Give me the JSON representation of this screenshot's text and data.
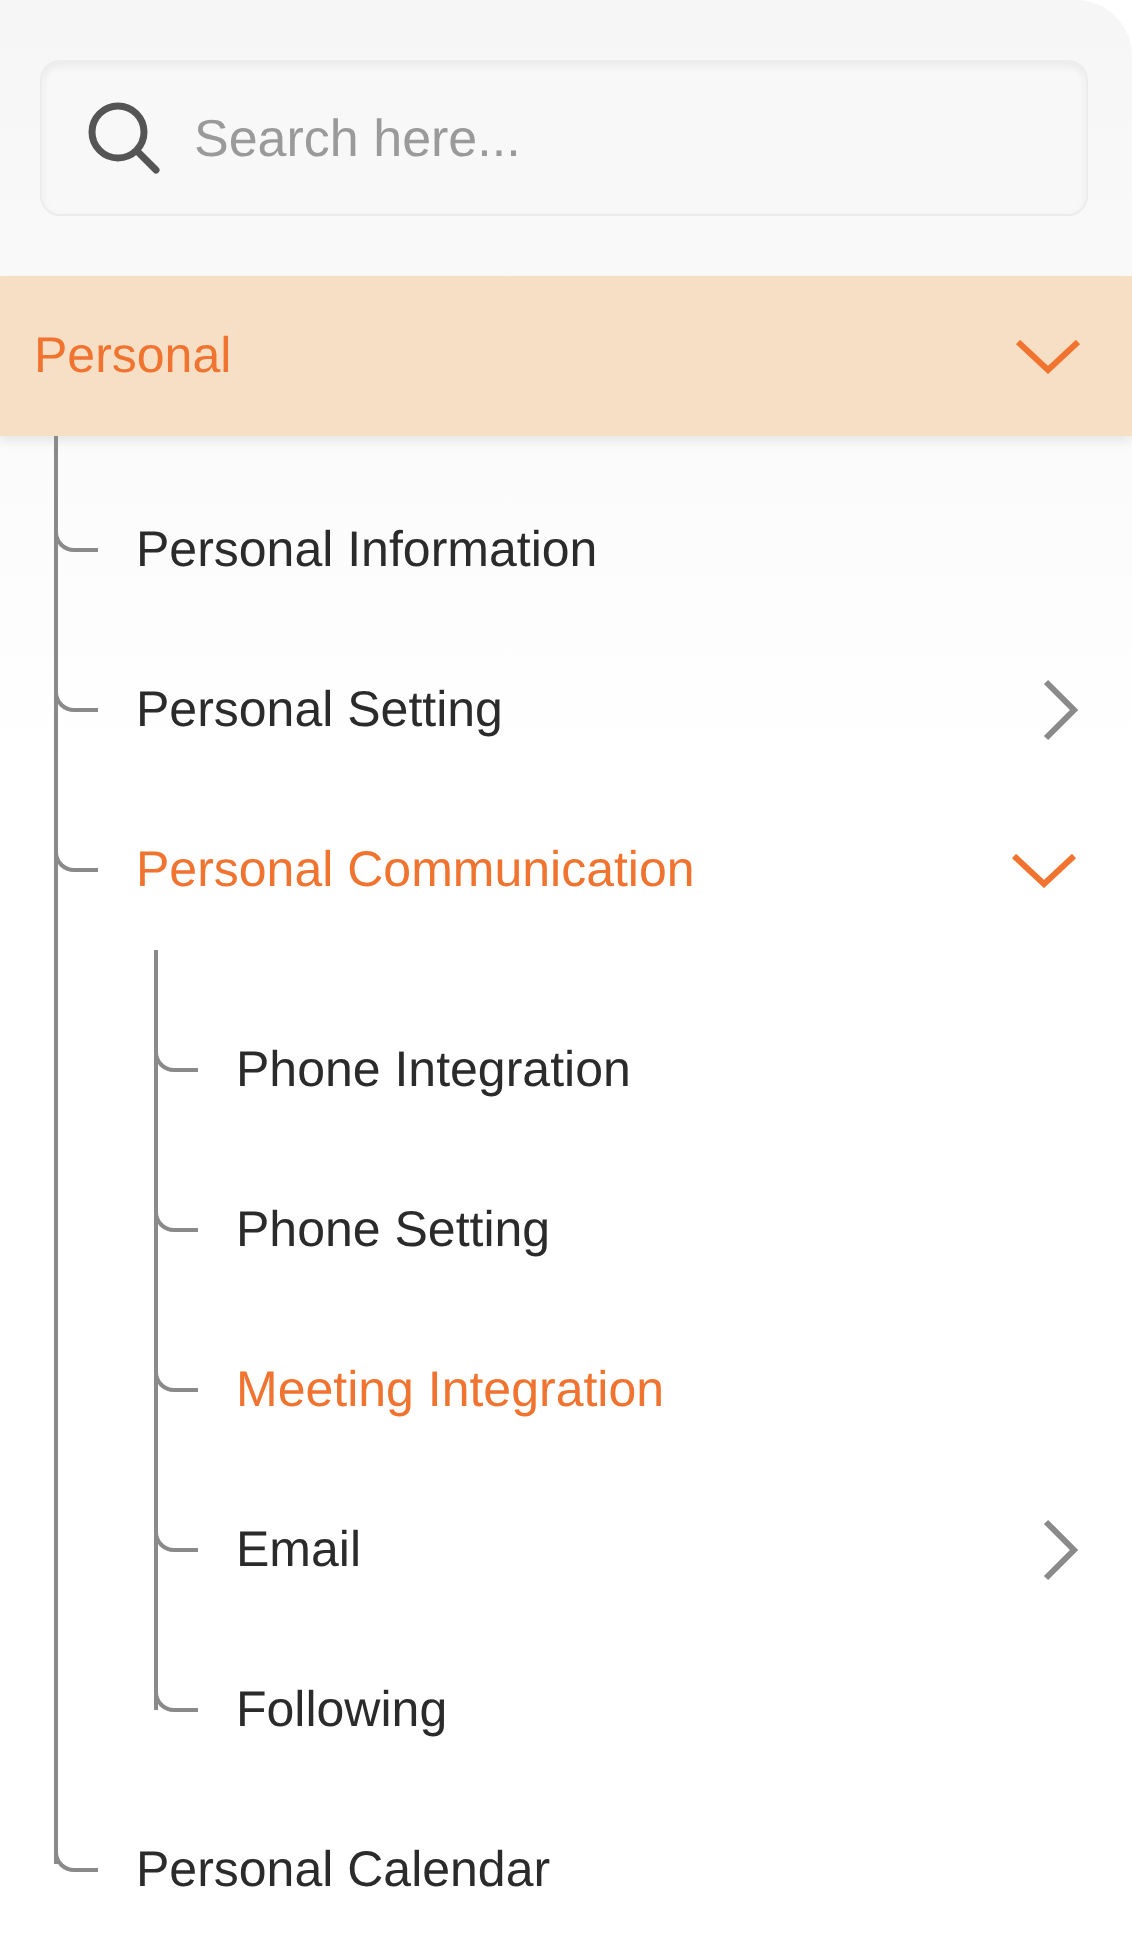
{
  "search": {
    "placeholder": "Search here..."
  },
  "tree": [
    {
      "label": "Personal",
      "selected": true,
      "expanded": true,
      "children": [
        {
          "label": "Personal Information",
          "selected": false
        },
        {
          "label": "Personal Setting",
          "selected": false,
          "expanded": false
        },
        {
          "label": "Personal Communication",
          "selected": true,
          "expanded": true,
          "children": [
            {
              "label": "Phone Integration",
              "selected": false
            },
            {
              "label": "Phone Setting",
              "selected": false
            },
            {
              "label": "Meeting Integration",
              "selected": true
            },
            {
              "label": "Email",
              "selected": false,
              "expanded": false
            },
            {
              "label": "Following",
              "selected": false
            }
          ]
        },
        {
          "label": "Personal Calendar",
          "selected": false
        }
      ]
    }
  ]
}
